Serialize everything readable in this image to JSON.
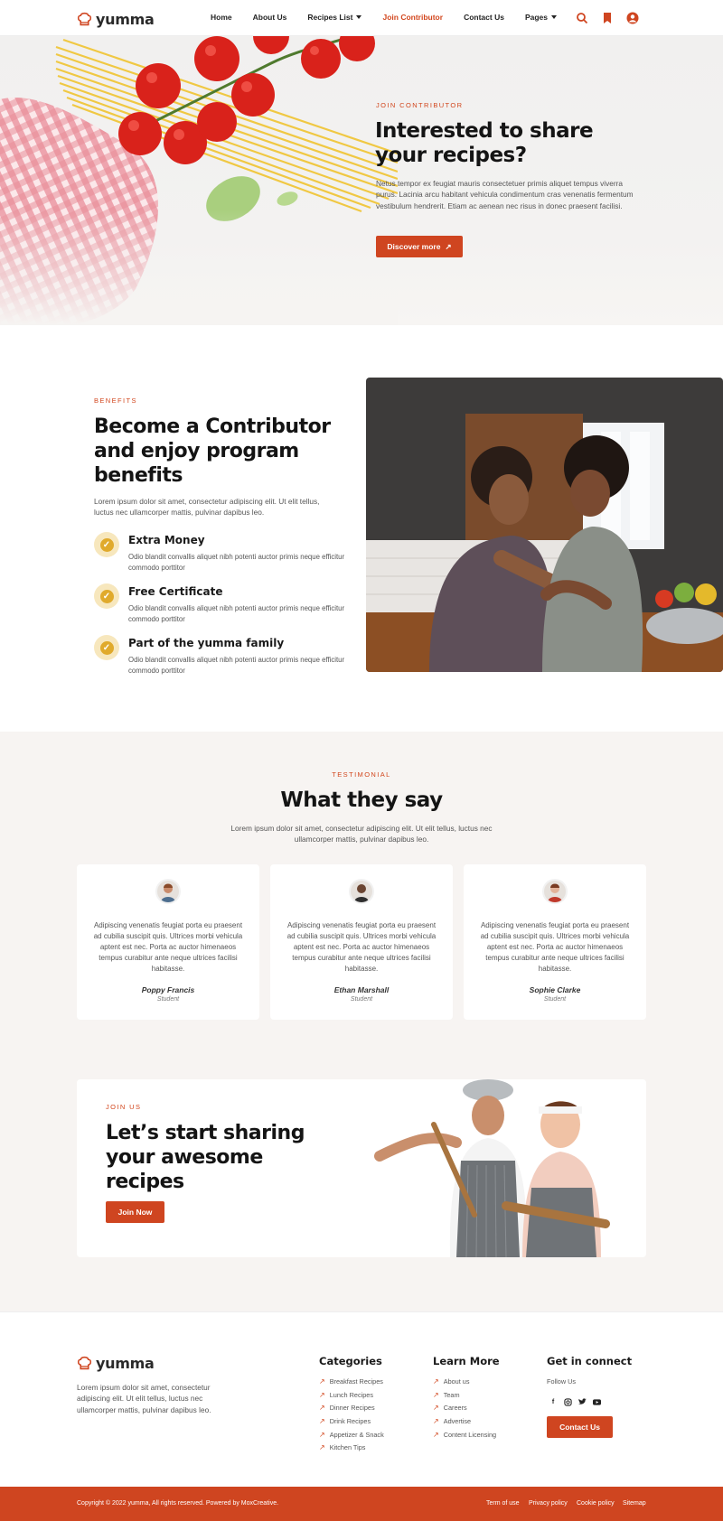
{
  "brand": {
    "name": "yumma",
    "accent": "#cf4520",
    "gold": "#e0aa2c"
  },
  "nav": {
    "items": [
      {
        "label": "Home",
        "dropdown": false,
        "active": false
      },
      {
        "label": "About Us",
        "dropdown": false,
        "active": false
      },
      {
        "label": "Recipes List",
        "dropdown": true,
        "active": false
      },
      {
        "label": "Join Contributor",
        "dropdown": false,
        "active": true
      },
      {
        "label": "Contact Us",
        "dropdown": false,
        "active": false
      },
      {
        "label": "Pages",
        "dropdown": true,
        "active": false
      }
    ],
    "icons": [
      "search-icon",
      "bookmark-icon",
      "user-icon"
    ]
  },
  "hero": {
    "eyebrow": "JOIN CONTRIBUTOR",
    "title": "Interested to share your recipes?",
    "text": "Netus tempor ex feugiat mauris consectetuer primis aliquet tempus viverra purus. Lacinia arcu habitant vehicula condimentum cras venenatis fermentum vestibulum hendrerit. Etiam ac aenean nec risus in donec praesent facilisi.",
    "button": "Discover more"
  },
  "benefits": {
    "eyebrow": "BENEFITS",
    "title": "Become a Contributor and enjoy program benefits",
    "text": "Lorem ipsum dolor sit amet, consectetur adipiscing elit. Ut elit tellus, luctus nec ullamcorper mattis, pulvinar dapibus leo.",
    "items": [
      {
        "title": "Extra Money",
        "desc": "Odio blandit convallis aliquet nibh potenti auctor primis neque efficitur commodo porttitor"
      },
      {
        "title": "Free Certificate",
        "desc": "Odio blandit convallis aliquet nibh potenti auctor primis neque efficitur commodo porttitor"
      },
      {
        "title": "Part of the yumma family",
        "desc": "Odio blandit convallis aliquet nibh potenti auctor primis neque efficitur commodo porttitor"
      }
    ]
  },
  "testimonial": {
    "eyebrow": "TESTIMONIAL",
    "title": "What they say",
    "text": "Lorem ipsum dolor sit amet, consectetur adipiscing elit. Ut elit tellus, luctus nec ullamcorper mattis, pulvinar dapibus leo.",
    "cards": [
      {
        "quote": "Adipiscing venenatis feugiat porta eu praesent ad cubilia suscipit quis. Ultrices morbi vehicula aptent est nec. Porta ac auctor himenaeos tempus curabitur ante neque ultrices facilisi habitasse.",
        "name": "Poppy Francis",
        "role": "Student"
      },
      {
        "quote": "Adipiscing venenatis feugiat porta eu praesent ad cubilia suscipit quis. Ultrices morbi vehicula aptent est nec. Porta ac auctor himenaeos tempus curabitur ante neque ultrices facilisi habitasse.",
        "name": "Ethan Marshall",
        "role": "Student"
      },
      {
        "quote": "Adipiscing venenatis feugiat porta eu praesent ad cubilia suscipit quis. Ultrices morbi vehicula aptent est nec. Porta ac auctor himenaeos tempus curabitur ante neque ultrices facilisi habitasse.",
        "name": "Sophie Clarke",
        "role": "Student"
      }
    ]
  },
  "join": {
    "eyebrow": "JOIN US",
    "title": "Let’s start sharing your awesome recipes",
    "button": "Join Now"
  },
  "footer": {
    "about": "Lorem ipsum dolor sit amet, consectetur adipiscing elit. Ut elit tellus, luctus nec ullamcorper mattis, pulvinar dapibus leo.",
    "categories": {
      "title": "Categories",
      "links": [
        "Breakfast Recipes",
        "Lunch Recipes",
        "Dinner Recipes",
        "Drink Recipes",
        "Appetizer & Snack",
        "Kitchen Tips"
      ]
    },
    "learn": {
      "title": "Learn More",
      "links": [
        "About us",
        "Team",
        "Careers",
        "Advertise",
        "Content Licensing"
      ]
    },
    "connect": {
      "title": "Get in connect",
      "follow": "Follow Us",
      "social": [
        "f",
        "◎",
        "🐦",
        "▶"
      ],
      "button": "Contact Us"
    },
    "copyright": "Copyright © 2022 yumma, All rights reserved. Powered by MoxCreative.",
    "bottom_links": [
      "Term of use",
      "Privacy policy",
      "Cookie policy",
      "Sitemap"
    ]
  }
}
